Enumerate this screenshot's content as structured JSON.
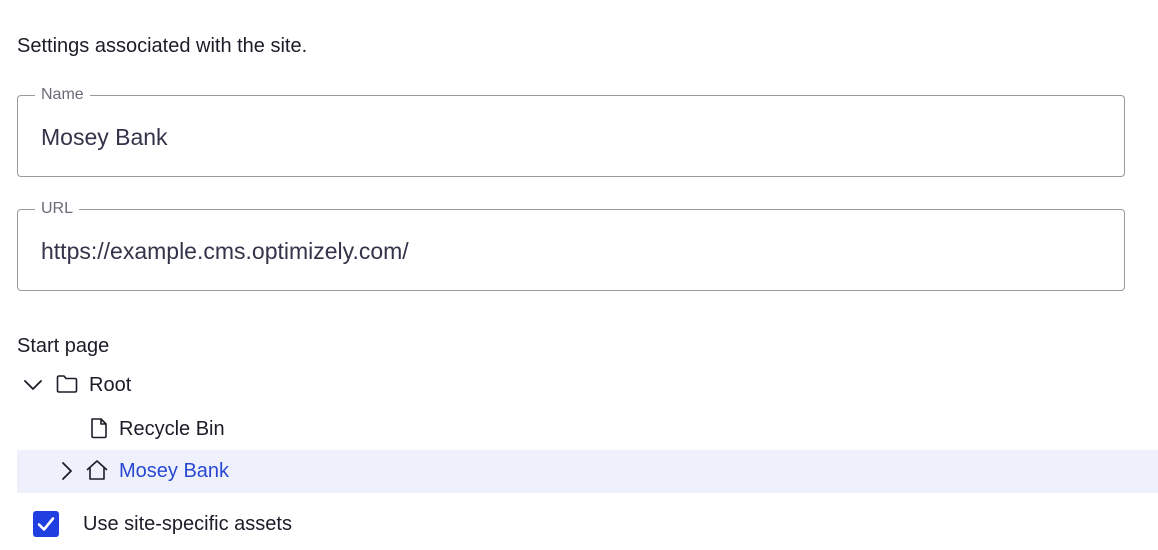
{
  "intro_text": "Settings associated with the site.",
  "fields": {
    "name": {
      "label": "Name",
      "value": "Mosey Bank"
    },
    "url": {
      "label": "URL",
      "value": "https://example.cms.optimizely.com/"
    }
  },
  "start_page": {
    "label": "Start page",
    "tree": [
      {
        "label": "Root",
        "icon": "folder-icon",
        "expanded": true
      },
      {
        "label": "Recycle Bin",
        "icon": "file-icon"
      },
      {
        "label": "Mosey Bank",
        "icon": "home-icon",
        "expanded": false,
        "selected": true
      }
    ]
  },
  "site_specific_assets": {
    "label": "Use site-specific assets",
    "checked": true
  },
  "colors": {
    "accent": "#1f3fe0",
    "selected_row_bg": "#eef1fb",
    "selected_text": "#2a47d1",
    "field_border": "#9a9aa2"
  }
}
